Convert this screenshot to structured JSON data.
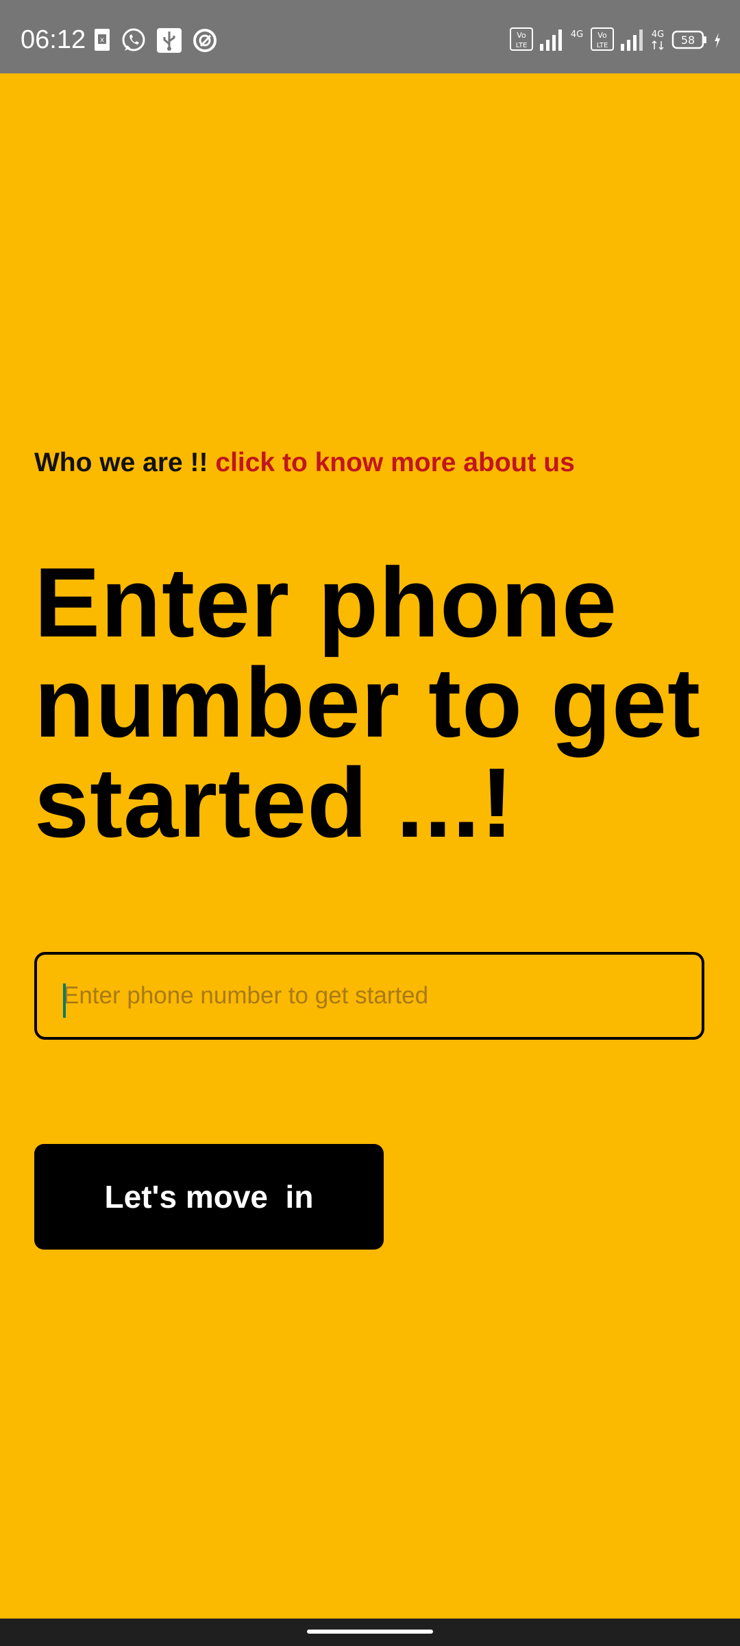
{
  "status_bar": {
    "time": "06:12",
    "battery_level": "58",
    "left_icons": [
      "sim-card-icon",
      "whatsapp-icon",
      "usb-icon",
      "data-saver-icon"
    ],
    "right_icons": [
      "volte-icon",
      "signal-icon",
      "4g-icon",
      "volte-icon",
      "signal-icon",
      "4g-icon",
      "battery-icon",
      "charging-icon"
    ],
    "background_color": "#767676"
  },
  "page": {
    "background_color": "#FBB900"
  },
  "about": {
    "prefix": "Who we are !!",
    "link": "click to know more about us",
    "link_color": "#C0161E"
  },
  "headline": "Enter phone number to get started ...!",
  "phone_input": {
    "placeholder": "Enter phone number to get started",
    "value": ""
  },
  "submit_button": {
    "label": "Let's move  in"
  }
}
